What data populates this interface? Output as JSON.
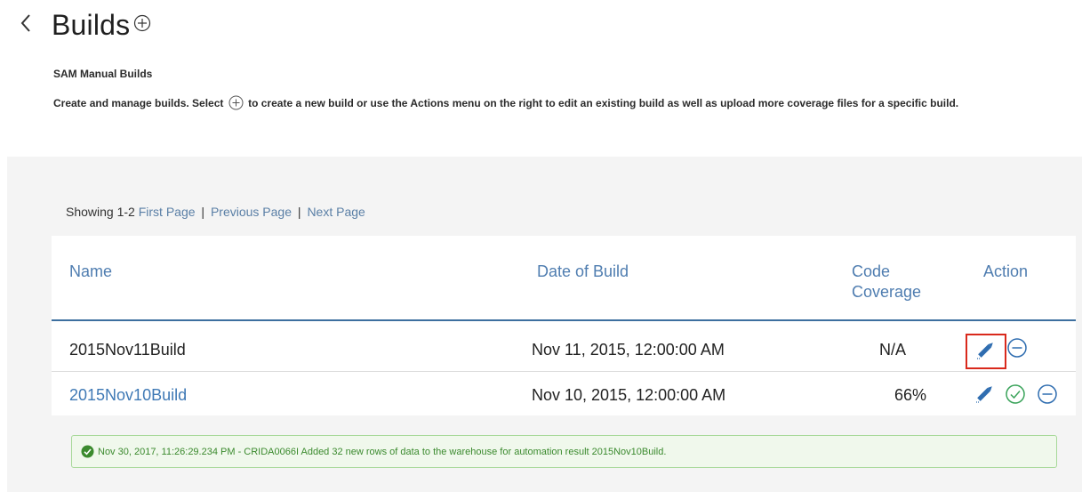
{
  "header": {
    "title": "Builds",
    "section_title": "SAM Manual Builds",
    "desc_before": "Create and manage builds. Select",
    "desc_after": "to create a new build or use the Actions menu on the right to edit an existing build as well as upload more coverage files for a specific build."
  },
  "paging": {
    "showing_label": "Showing",
    "range": "1-2",
    "first": "First Page",
    "previous": "Previous Page",
    "next": "Next Page",
    "separator": "|"
  },
  "table": {
    "columns": {
      "name": "Name",
      "date": "Date of Build",
      "coverage_line1": "Code",
      "coverage_line2": "Coverage",
      "action": "Action"
    },
    "rows": [
      {
        "name": "2015Nov11Build",
        "date": "Nov 11, 2015, 12:00:00 AM",
        "coverage": "N/A"
      },
      {
        "name": "2015Nov10Build",
        "date": "Nov 10, 2015, 12:00:00 AM",
        "coverage": "66%"
      }
    ]
  },
  "notification": {
    "text": "Nov 30, 2017, 11:26:29.234 PM - CRIDA0066I Added 32 new rows of data to the warehouse for automation result 2015Nov10Build."
  },
  "icons": {
    "back": "chevron-left-icon",
    "add": "add-circle-icon",
    "edit": "pencil-icon",
    "remove": "minus-circle-icon",
    "check": "check-circle-icon",
    "success": "success-check-icon"
  },
  "colors": {
    "link": "#4f7db0",
    "accent": "#3d6f9f",
    "success": "#3b8a2e",
    "highlight": "#d9291c",
    "panel_bg": "#f4f4f4"
  }
}
